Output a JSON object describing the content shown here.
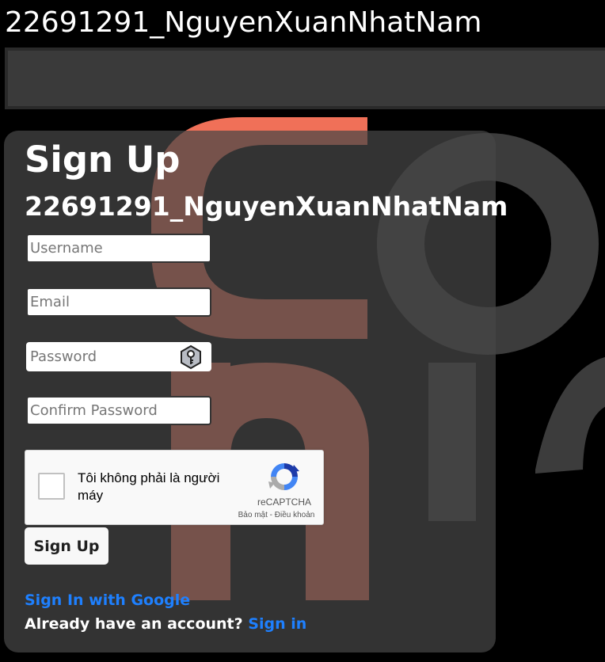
{
  "header": {
    "title": "22691291_NguyenXuanNhatNam"
  },
  "form": {
    "title": "Sign Up",
    "subtitle": "22691291_NguyenXuanNhatNam",
    "username": {
      "placeholder": "Username",
      "value": ""
    },
    "email": {
      "placeholder": "Email",
      "value": ""
    },
    "password": {
      "placeholder": "Password",
      "value": "",
      "icon": "password-key-icon"
    },
    "confirm_password": {
      "placeholder": "Confirm Password",
      "value": ""
    },
    "submit_label": "Sign Up",
    "google_link": "Sign In with Google",
    "account_prompt": "Already have an account?",
    "signin_link": "Sign in"
  },
  "recaptcha": {
    "label": "Tôi không phải là người máy",
    "brand": "reCAPTCHA",
    "privacy": "Bảo mật",
    "separator": " - ",
    "terms": "Điều khoản"
  },
  "colors": {
    "background": "#000000",
    "card": "#464646",
    "link": "#1e80ff",
    "logo_accent": "#f07058",
    "logo_gray": "#3c3c3c"
  }
}
